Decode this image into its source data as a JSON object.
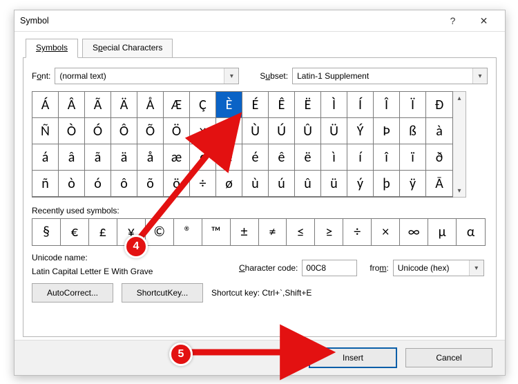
{
  "dialog": {
    "title": "Symbol",
    "help": "?",
    "close": "✕"
  },
  "tabs": {
    "symbols": "Symbols",
    "special": "Special Characters"
  },
  "font": {
    "label_pre": "F",
    "label_ul": "o",
    "label_post": "nt:",
    "value": "(normal text)"
  },
  "subset": {
    "label_pre": "S",
    "label_ul": "u",
    "label_post": "bset:",
    "value": "Latin-1 Supplement"
  },
  "grid": {
    "selected_index": 7,
    "rows": [
      [
        "Á",
        "Â",
        "Ã",
        "Ä",
        "Å",
        "Æ",
        "Ç",
        "È",
        "É",
        "Ê",
        "Ë",
        "Ì",
        "Í",
        "Î",
        "Ï",
        "Ð"
      ],
      [
        "Ñ",
        "Ò",
        "Ó",
        "Ô",
        "Õ",
        "Ö",
        "×",
        "Ø",
        "Ù",
        "Ú",
        "Û",
        "Ü",
        "Ý",
        "Þ",
        "ß",
        "à"
      ],
      [
        "á",
        "â",
        "ã",
        "ä",
        "å",
        "æ",
        "ç",
        "è",
        "é",
        "ê",
        "ë",
        "ì",
        "í",
        "î",
        "ï",
        "ð"
      ],
      [
        "ñ",
        "ò",
        "ó",
        "ô",
        "õ",
        "ö",
        "÷",
        "ø",
        "ù",
        "ú",
        "û",
        "ü",
        "ý",
        "þ",
        "ÿ",
        "Ā"
      ]
    ]
  },
  "recent": {
    "label_pre": "",
    "label_ul": "R",
    "label_post": "ecently used symbols:",
    "items": [
      "§",
      "€",
      "£",
      "¥",
      "©",
      "®",
      "™",
      "±",
      "≠",
      "≤",
      "≥",
      "÷",
      "×",
      "∞",
      "μ",
      "α"
    ]
  },
  "unicode": {
    "name_label": "Unicode name:",
    "name_value": "Latin Capital Letter E With Grave",
    "code_label_ul": "C",
    "code_label_post": "haracter code:",
    "code_value": "00C8",
    "from_label_pre": "fro",
    "from_label_ul": "m",
    "from_label_post": ":",
    "from_value": "Unicode (hex)"
  },
  "buttons": {
    "autocorrect_ul": "A",
    "autocorrect_post": "utoCorrect...",
    "shortcut_pre": "Shortcut ",
    "shortcut_ul": "K",
    "shortcut_post": "ey...",
    "shortcut_info": "Shortcut key: Ctrl+`,Shift+E",
    "insert_ul": "I",
    "insert_post": "nsert",
    "cancel": "Cancel"
  },
  "annotations": {
    "badge4": "4",
    "badge5": "5"
  }
}
